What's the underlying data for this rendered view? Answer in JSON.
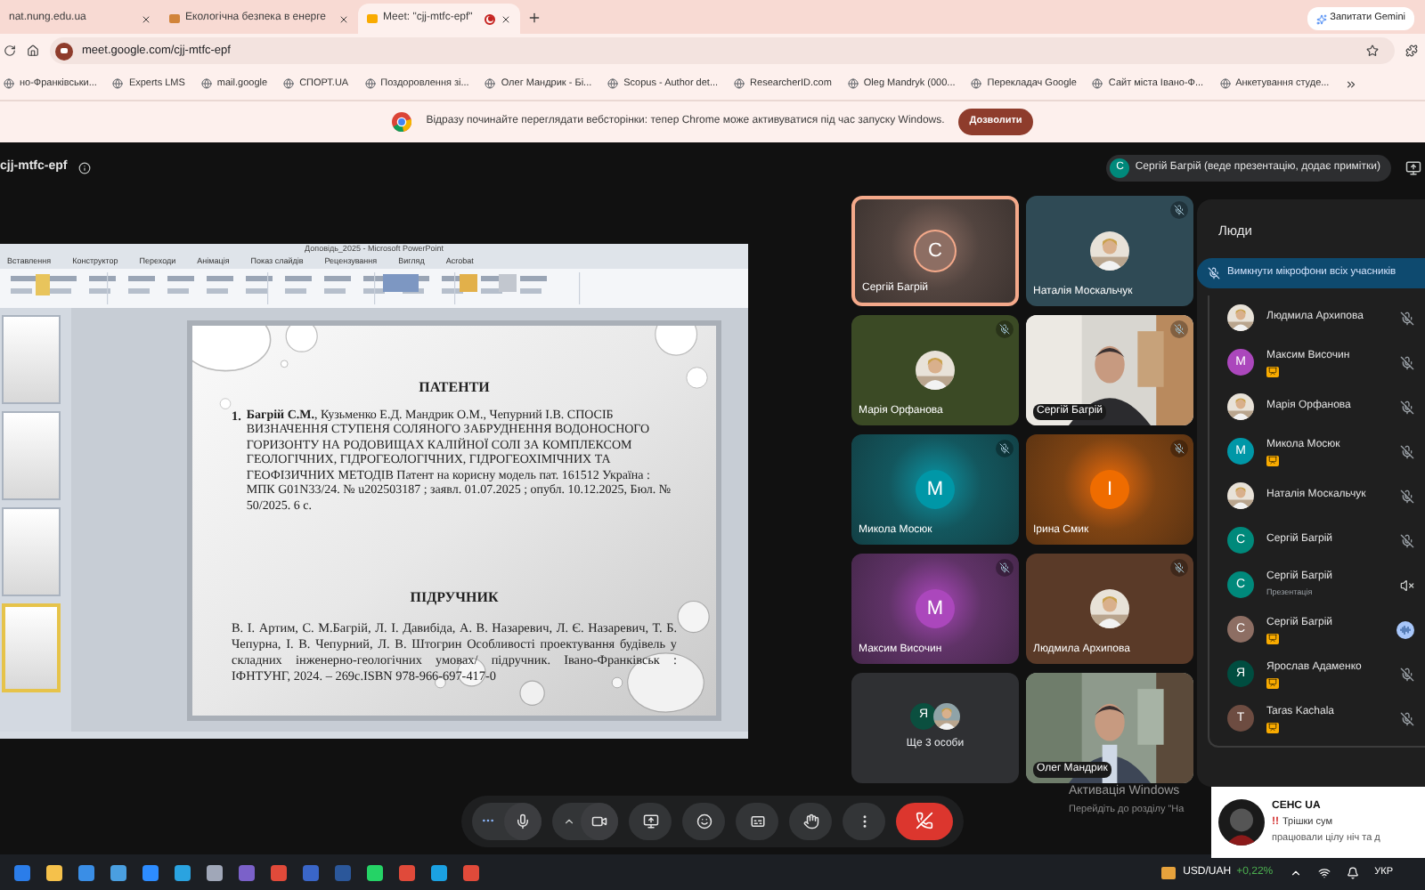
{
  "browser": {
    "tabs": [
      {
        "title": "nat.nung.edu.ua",
        "selected": false,
        "recording": false
      },
      {
        "title": "Екологічна безпека в енерге",
        "selected": false,
        "recording": false
      },
      {
        "title": "Meet: \"cjj-mtfc-epf\"",
        "selected": true,
        "recording": true
      }
    ],
    "gemini_button": "Запитати Gemini",
    "address": "meet.google.com/cjj-mtfc-epf",
    "bookmarks": [
      "но-Франківськи...",
      "Experts LMS",
      "mail.google",
      "СПОРТ.UA",
      "Поздоровлення зі...",
      "Олег Мандрик - Бі...",
      "Scopus - Author det...",
      "ResearcherID.com",
      "Oleg Mandryk (000...",
      "Перекладач Google",
      "Сайт міста Івано-Ф...",
      "Анкетування студе..."
    ],
    "banner": {
      "text": "Відразу починайте переглядати вебсторінки: тепер Chrome може активуватися під час запуску Windows.",
      "button": "Дозволити"
    }
  },
  "meeting": {
    "code": "cjj-mtfc-epf",
    "presenter_initial": "С",
    "presenter": "Сергій Багрій (веде презентацію, додає примітки)"
  },
  "presentation": {
    "window_title": "Доповідь_2025 - Microsoft PowerPoint",
    "ribbon_tabs": [
      "Вставлення",
      "Конструктор",
      "Переходи",
      "Анімація",
      "Показ слайдів",
      "Рецензування",
      "Вигляд",
      "Acrobat"
    ],
    "thumbnails": [
      {
        "selected": false
      },
      {
        "selected": false
      },
      {
        "selected": false
      },
      {
        "selected": true
      }
    ],
    "slide": {
      "heading_1": "ПАТЕНТИ",
      "patent_number": "1.",
      "patent": "**Багрій С.М.**, Кузьменко Е.Д. Мандрик О.М., Чепурний І.В. СПОСІБ ВИЗНАЧЕННЯ СТУПЕНЯ СОЛЯНОГО ЗАБРУДНЕННЯ ВОДОНОСНОГО ГОРИЗОНТУ НА РОДОВИЩАХ КАЛІЙНОЇ СОЛІ ЗА КОМПЛЕКСОМ ГЕОЛОГІЧНИХ, ГІДРОГЕОЛОГІЧНИХ, ГІДРОГЕОХІМІЧНИХ ТА ГЕОФІЗИЧНИХ МЕТОДІВ Патент на корисну модель пат. 161512 Україна : МПК G01N33/24. № u202503187 ; заявл. 01.07.2025 ; опубл. 10.12.2025, Бюл. № 50/2025. 6 с.",
      "heading_2": "ПІДРУЧНИК",
      "textbook": "В. І. Артим, С. М.Багрій, Л. І. Давибіда, А. В. Назаревич, Л. Є. Назаревич, Т. Б. Чепурна, І. В. Чепурний, Л. В. Штогрин Особливості проектування будівель у складних інженерно-геологічних умовах/ підручник. Івано-Франківськ : ІФНТУНГ, 2024. – 269с.ISBN 978-966-697-417-0"
    }
  },
  "tiles": [
    {
      "kind": "letter",
      "name": "Сергій Багрій",
      "letter": "С",
      "color": "#8d6e63",
      "muted": false,
      "speaking": true
    },
    {
      "name": "Наталія Москальчук",
      "color": "#2f4a55",
      "muted": true,
      "speaking": false
    },
    {
      "name": "Марія Орфанова",
      "color": "#3b4a25",
      "muted": true,
      "speaking": false
    },
    {
      "kind": "video",
      "name": "Сергій Багрій",
      "muted": true,
      "speaking": false
    },
    {
      "kind": "letter",
      "name": "Микола Мосюк",
      "letter": "М",
      "color": "#0097a7",
      "muted": true,
      "speaking": false
    },
    {
      "kind": "letter",
      "name": "Ірина Смик",
      "letter": "І",
      "color": "#ef6c00",
      "muted": true,
      "speaking": false
    },
    {
      "kind": "letter",
      "name": "Максим Височин",
      "letter": "М",
      "color": "#ab47bc",
      "muted": true,
      "speaking": false
    },
    {
      "name": "Людмила Архипова",
      "color": "#5a3a28",
      "muted": true,
      "speaking": false
    },
    {
      "kind": "more",
      "name": "Ще 3 особи",
      "letter": "Я",
      "color": "#0b4f3f",
      "muted": false,
      "speaking": false
    },
    {
      "kind": "video",
      "name": "Олег Мандрик",
      "muted": false,
      "speaking": false
    }
  ],
  "people": {
    "title": "Люди",
    "mute_all": "Вимкнути мікрофони всіх учасників",
    "list": [
      {
        "name": "Людмила Архипова",
        "badge": false,
        "muted": true,
        "sound_off": false,
        "speaking": false
      },
      {
        "kind": "letter",
        "name": "Максим Височин",
        "letter": "М",
        "color": "#ab47bc",
        "badge": true,
        "muted": true,
        "sound_off": false,
        "speaking": false
      },
      {
        "name": "Марія Орфанова",
        "badge": false,
        "muted": true,
        "sound_off": false,
        "speaking": false
      },
      {
        "kind": "letter",
        "name": "Микола Мосюк",
        "letter": "М",
        "color": "#0097a7",
        "badge": true,
        "muted": true,
        "sound_off": false,
        "speaking": false
      },
      {
        "name": "Наталія Москальчук",
        "badge": false,
        "muted": true,
        "sound_off": false,
        "speaking": false
      },
      {
        "kind": "letter",
        "name": "Сергій Багрій",
        "letter": "С",
        "color": "#00897b",
        "badge": false,
        "muted": true,
        "sound_off": false,
        "speaking": false
      },
      {
        "kind": "letter",
        "name": "Сергій Багрій",
        "letter": "С",
        "color": "#00897b",
        "subtitle": "Презентація",
        "badge": false,
        "muted": false,
        "sound_off": true,
        "speaking": false
      },
      {
        "kind": "letter",
        "name": "Сергій Багрій",
        "letter": "С",
        "color": "#8d6e63",
        "badge": true,
        "muted": false,
        "sound_off": false,
        "speaking": true
      },
      {
        "kind": "letter",
        "name": "Ярослав Адаменко",
        "letter": "Я",
        "color": "#004d40",
        "badge": true,
        "muted": true,
        "sound_off": false,
        "speaking": false
      },
      {
        "kind": "letter",
        "name": "Taras Kachala",
        "letter": "Т",
        "color": "#6d4c41",
        "badge": true,
        "muted": true,
        "sound_off": false,
        "speaking": false
      }
    ]
  },
  "controls": [
    {
      "kind": "more"
    },
    {
      "kind": "mic"
    },
    {
      "kind": "camera"
    },
    {
      "kind": "present"
    },
    {
      "kind": "reactions"
    },
    {
      "kind": "captions"
    },
    {
      "kind": "hand"
    },
    {
      "kind": "options"
    },
    {
      "kind": "leave"
    }
  ],
  "windows_notice": {
    "title": "Активація Windows",
    "text": "Перейдіть до розділу \"На"
  },
  "toast": {
    "source": "СЕНС UA",
    "alert": "!!",
    "line_1": "Трішки сум",
    "line_2": "працювали цілу ніч та д"
  },
  "taskbar": {
    "ticker": "USD/UAH",
    "change": "+0,22%",
    "language": "УКР"
  }
}
